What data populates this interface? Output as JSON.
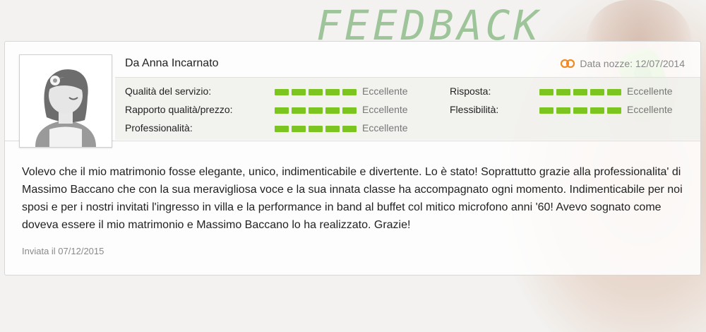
{
  "banner": {
    "title": "FEEDBACK"
  },
  "review": {
    "reviewer_name": "Da Anna Incarnato",
    "wedding_date_label": "Data nozze: 12/07/2014",
    "ratings_left": [
      {
        "label": "Qualità del servizio:",
        "value": "Eccellente",
        "score": 5,
        "max": 5
      },
      {
        "label": "Rapporto qualità/prezzo:",
        "value": "Eccellente",
        "score": 5,
        "max": 5
      },
      {
        "label": "Professionalità:",
        "value": "Eccellente",
        "score": 5,
        "max": 5
      }
    ],
    "ratings_right": [
      {
        "label": "Risposta:",
        "value": "Eccellente",
        "score": 5,
        "max": 5
      },
      {
        "label": "Flessibilità:",
        "value": "Eccellente",
        "score": 5,
        "max": 5
      }
    ],
    "text": "Volevo che il mio matrimonio fosse elegante, unico, indimenticabile e divertente. Lo è stato! Soprattutto grazie alla professionalita' di Massimo Baccano che con la sua meravigliosa voce e la sua innata classe ha accompagnato ogni momento. Indimenticabile per noi sposi e per i nostri invitati l'ingresso in villa e la performance in band al buffet col mitico microfono anni '60! Avevo sognato come doveva essere il mio matrimonio e Massimo Baccano lo ha realizzato. Grazie!",
    "sent_date": "Inviata il 07/12/2015"
  },
  "icons": {
    "avatar": "female-avatar-icon",
    "rings": "wedding-rings-icon"
  },
  "colors": {
    "rating_bar": "#7cc520",
    "title": "#9ec49a",
    "rings": "#f08a24"
  }
}
